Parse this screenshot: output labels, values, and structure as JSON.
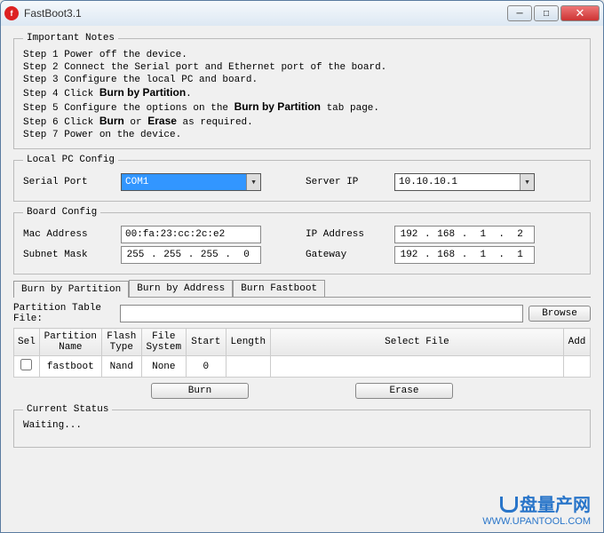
{
  "window": {
    "title": "FastBoot3.1"
  },
  "notes": {
    "legend": "Important Notes",
    "step1": "Step 1 Power off the device.",
    "step2": "Step 2 Connect the Serial port and Ethernet port of the board.",
    "step3": "Step 3 Configure the local PC and board.",
    "step4a": "Step 4 Click ",
    "step4b": "Burn by Partition",
    "step4c": ".",
    "step5a": "Step 5 Configure the options on the ",
    "step5b": "Burn by Partition",
    "step5c": " tab page.",
    "step6a": "Step 6 Click ",
    "step6b": "Burn",
    "step6c": " or ",
    "step6d": "Erase",
    "step6e": " as required.",
    "step7": "Step 7 Power on the device."
  },
  "localpc": {
    "legend": "Local PC Config",
    "serial_label": "Serial Port",
    "serial_value": "COM1",
    "serverip_label": "Server IP",
    "serverip_value": "10.10.10.1"
  },
  "board": {
    "legend": "Board Config",
    "mac_label": "Mac Address",
    "mac_value": "00:fa:23:cc:2c:e2",
    "ip_label": "IP Address",
    "ip": [
      "192",
      "168",
      "1",
      "2"
    ],
    "subnet_label": "Subnet Mask",
    "subnet": [
      "255",
      "255",
      "255",
      "0"
    ],
    "gateway_label": "Gateway",
    "gateway": [
      "192",
      "168",
      "1",
      "1"
    ]
  },
  "tabs": {
    "t1": "Burn by Partition",
    "t2": "Burn by Address",
    "t3": "Burn Fastboot"
  },
  "ptf": {
    "label": "Partition Table File:",
    "value": "",
    "browse": "Browse"
  },
  "table": {
    "headers": {
      "sel": "Sel",
      "pname": "Partition Name",
      "ftype": "Flash Type",
      "fsys": "File System",
      "start": "Start",
      "length": "Length",
      "sfile": "Select File",
      "add": "Add"
    },
    "row": {
      "pname": "fastboot",
      "ftype": "Nand",
      "fsys": "None",
      "start": "0",
      "length": "",
      "sfile": ""
    }
  },
  "actions": {
    "burn": "Burn",
    "erase": "Erase"
  },
  "status": {
    "legend": "Current Status",
    "text": "Waiting..."
  },
  "watermark": {
    "cn": "盘量产网",
    "url": "WWW.UPANTOOL.COM"
  }
}
